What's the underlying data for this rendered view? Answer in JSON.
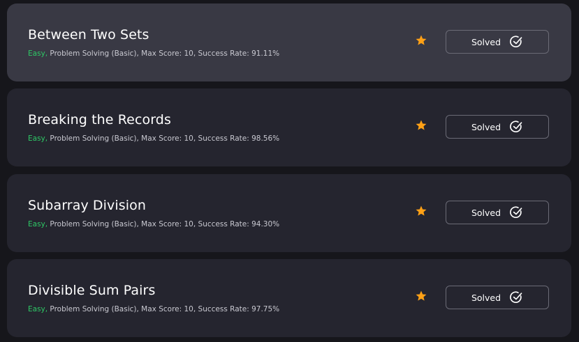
{
  "challenges": [
    {
      "title": "Between Two Sets",
      "difficulty": "Easy,",
      "details": " Problem Solving (Basic), Max Score: 10, Success Rate: 91.11%",
      "status": "Solved"
    },
    {
      "title": "Breaking the Records",
      "difficulty": "Easy,",
      "details": " Problem Solving (Basic), Max Score: 10, Success Rate: 98.56%",
      "status": "Solved"
    },
    {
      "title": "Subarray Division",
      "difficulty": "Easy,",
      "details": " Problem Solving (Basic), Max Score: 10, Success Rate: 94.30%",
      "status": "Solved"
    },
    {
      "title": "Divisible Sum Pairs",
      "difficulty": "Easy,",
      "details": " Problem Solving (Basic), Max Score: 10, Success Rate: 97.75%",
      "status": "Solved"
    }
  ],
  "colors": {
    "easy": "#2ec866",
    "star": "#ffa116",
    "background": "#16161b",
    "card": "#25252f",
    "card_hover": "#393944"
  },
  "icons": {
    "bookmark": "star-icon",
    "solved": "check-circle-icon"
  }
}
